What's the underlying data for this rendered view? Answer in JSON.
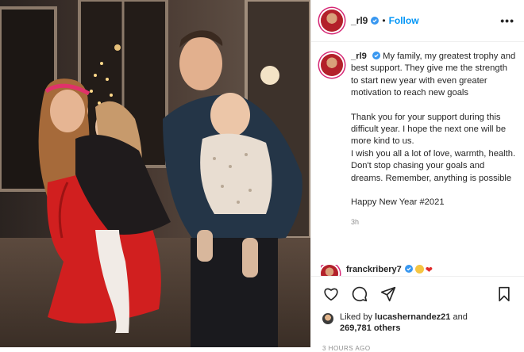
{
  "post": {
    "username": "_rl9",
    "follow_label": "Follow",
    "more_label": "•••",
    "separator": "•"
  },
  "caption": {
    "username": "_rl9",
    "lines_p1": "My family, my greatest trophy and best support. They give me the strength to start new year with even greater motivation to reach new goals",
    "lines_p2": "Thank you for your support during this difficult year. I hope the next one will be more kind to us.",
    "lines_p3": "I wish you all a lot of love, warmth, health. Don't stop chasing your goals and dreams. Remember, anything is possible",
    "lines_p4": "Happy New Year #2021",
    "time_ago": "3h"
  },
  "comment": {
    "username": "franckribery7"
  },
  "likes": {
    "prefix": "Liked by",
    "user": "lucashernandez21",
    "conj": "and",
    "count": "269,781 others"
  },
  "posted": "3 HOURS AGO",
  "colors": {
    "accent": "#0095f6",
    "text": "#262626",
    "muted": "#8e8e8e",
    "heart": "#e02b2b"
  },
  "icons": [
    "verified-icon",
    "heart-icon",
    "comment-icon",
    "share-icon",
    "bookmark-icon",
    "more-icon"
  ]
}
